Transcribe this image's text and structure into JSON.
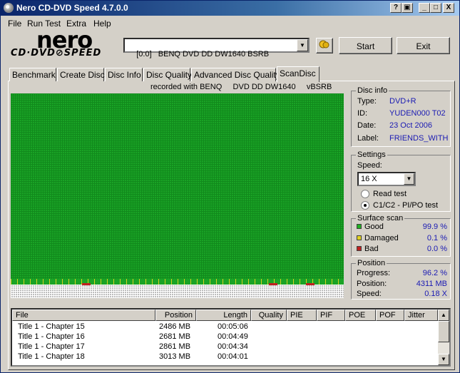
{
  "window": {
    "title": "Nero CD-DVD Speed 4.7.0.0"
  },
  "title_buttons": {
    "minimize": "_",
    "maximize": "□",
    "close": "X"
  },
  "menu": [
    "File",
    "Run Test",
    "Extra",
    "Help"
  ],
  "logo": {
    "brand": "nero",
    "product": "CD·DVD⊘SPEED"
  },
  "toolbar": {
    "drive": "[0:0]   BENQ DVD DD DW1640 BSRB",
    "start_label": "Start",
    "exit_label": "Exit"
  },
  "tabs": [
    "Benchmark",
    "Create Disc",
    "Disc Info",
    "Disc Quality",
    "Advanced Disc Quality",
    "ScanDisc"
  ],
  "active_tab": "ScanDisc",
  "recorded_with": "recorded with BENQ     DVD DD DW1640     vBSRB",
  "disc_info": {
    "legend": "Disc info",
    "rows": [
      {
        "label": "Type:",
        "value": "DVD+R"
      },
      {
        "label": "ID:",
        "value": "YUDEN000 T02"
      },
      {
        "label": "Date:",
        "value": "23 Oct 2006"
      },
      {
        "label": "Label:",
        "value": "FRIENDS_WITH"
      }
    ]
  },
  "settings": {
    "legend": "Settings",
    "speed_label": "Speed:",
    "speed_value": "16 X",
    "read_test_label": "Read test",
    "c1c2_label": "C1/C2 - PI/PO test",
    "selected": "c1c2"
  },
  "surface_scan": {
    "legend": "Surface scan",
    "rows": [
      {
        "label": "Good",
        "value": "99.9 %",
        "color": "#22b022"
      },
      {
        "label": "Damaged",
        "value": "0.1 %",
        "color": "#e0d020"
      },
      {
        "label": "Bad",
        "value": "0.0 %",
        "color": "#c02020"
      }
    ]
  },
  "position": {
    "legend": "Position",
    "rows": [
      {
        "label": "Progress:",
        "value": "96.2 %"
      },
      {
        "label": "Position:",
        "value": "4311 MB"
      },
      {
        "label": "Speed:",
        "value": "0.18 X"
      }
    ]
  },
  "file_list": {
    "columns": [
      "File",
      "Position",
      "Length",
      "Quality",
      "PIE",
      "PIF",
      "POE",
      "POF",
      "Jitter"
    ],
    "rows": [
      {
        "file": "Title 1 -  Chapter 15",
        "position": "2486 MB",
        "length": "00:05:06"
      },
      {
        "file": "Title 1 -  Chapter 16",
        "position": "2681 MB",
        "length": "00:04:49"
      },
      {
        "file": "Title 1 -  Chapter 17",
        "position": "2861 MB",
        "length": "00:04:34"
      },
      {
        "file": "Title 1 -  Chapter 18",
        "position": "3013 MB",
        "length": "00:04:01"
      }
    ]
  }
}
